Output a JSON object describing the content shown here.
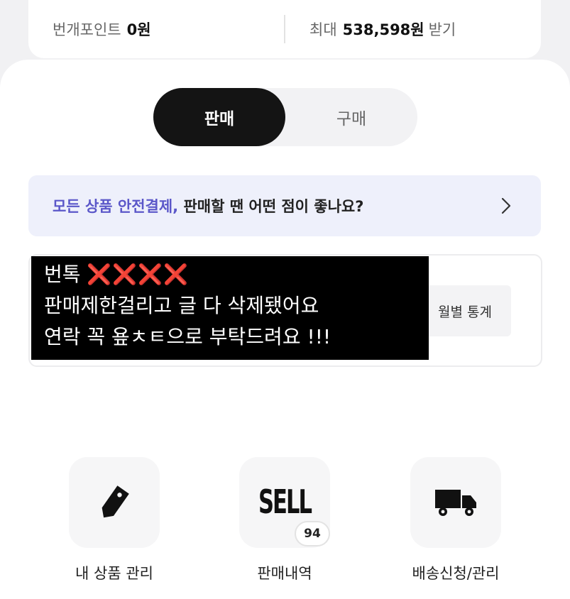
{
  "points": {
    "label": "번개포인트",
    "value": "0원",
    "max_label": "최대",
    "max_value": "538,598원",
    "max_suffix": "받기"
  },
  "tabs": {
    "sell": "판매",
    "buy": "구매"
  },
  "banner": {
    "highlight": "모든 상품 안전결제,",
    "text": " 판매할 땐 어떤 점이 좋나요?"
  },
  "stats": {
    "monthly_button": "월별 통계"
  },
  "notice": {
    "line1_prefix": "번톡 ",
    "line1_marks": "❌❌❌❌",
    "line2": "판매제한걸리고 글 다 삭제됐어요",
    "line3": "연락 꼭 욮ㅊㅌ으로 부탁드려요 !!!"
  },
  "menu": {
    "my_products": "내 상품 관리",
    "sales_history": "판매내역",
    "sales_history_icon_text": "SELL",
    "sales_count": "94",
    "shipping": "배송신청/관리"
  },
  "colors": {
    "accent": "#5b57c9",
    "tab_active_bg": "#141414",
    "banner_bg": "#eef0fb",
    "notice_bg": "#000000",
    "notice_marks": "#e8202a"
  }
}
